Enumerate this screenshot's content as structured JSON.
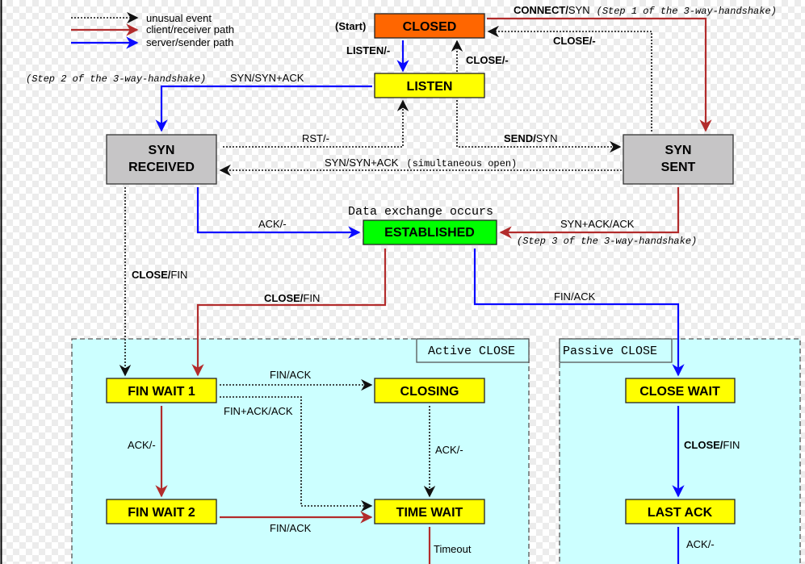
{
  "legend": {
    "unusual": "unusual event",
    "client": "client/receiver path",
    "server": "server/sender path"
  },
  "colors": {
    "closed": "#ff6600",
    "listen_wait": "#ffff00",
    "syn": "#c6c5c6",
    "established": "#00ff00",
    "close_region": "#ccffff",
    "client_path": "#b22c2c",
    "server_path": "#0a0aff",
    "unusual_path": "#111111"
  },
  "states": {
    "closed": "CLOSED",
    "listen": "LISTEN",
    "syn_received_1": "SYN",
    "syn_received_2": "RECEIVED",
    "syn_sent_1": "SYN",
    "syn_sent_2": "SENT",
    "established": "ESTABLISHED",
    "fin_wait_1": "FIN WAIT 1",
    "closing": "CLOSING",
    "fin_wait_2": "FIN WAIT 2",
    "time_wait": "TIME WAIT",
    "close_wait": "CLOSE WAIT",
    "last_ack": "LAST ACK"
  },
  "regions": {
    "active": "Active CLOSE",
    "passive": "Passive CLOSE"
  },
  "notes": {
    "start": "(Start)",
    "step1": "(Step 1 of the 3-way-handshake)",
    "step2": "(Step 2 of the 3-way-handshake)",
    "step3": "(Step 3 of the 3-way-handshake)",
    "simultaneous": "(simultaneous open)",
    "data_exchange": "Data exchange occurs"
  },
  "transitions": {
    "connect_b": "CONNECT/",
    "connect_n": "SYN",
    "close_synsent": "CLOSE/-",
    "listen": "LISTEN/-",
    "close_listen": "CLOSE/-",
    "syn_synack": "SYN/SYN+ACK",
    "rst": "RST/-",
    "send_b": "SEND/",
    "send_n": "SYN",
    "syn_synack_sim": "SYN/SYN+ACK",
    "ack_synrcvd": "ACK/-",
    "synack_ack": "SYN+ACK/ACK",
    "close_fin_synrcvd_b": "CLOSE/",
    "close_fin_synrcvd_n": "FIN",
    "close_fin_est_b": "CLOSE/",
    "close_fin_est_n": "FIN",
    "fin_ack_est": "FIN/ACK",
    "fin_ack_fw1": "FIN/ACK",
    "finack_ack": "FIN+ACK/ACK",
    "ack_fw1": "ACK/-",
    "ack_closing": "ACK/-",
    "fin_ack_fw2": "FIN/ACK",
    "timeout": "Timeout",
    "close_fin_cw_b": "CLOSE/",
    "close_fin_cw_n": "FIN",
    "ack_lastack": "ACK/-"
  }
}
